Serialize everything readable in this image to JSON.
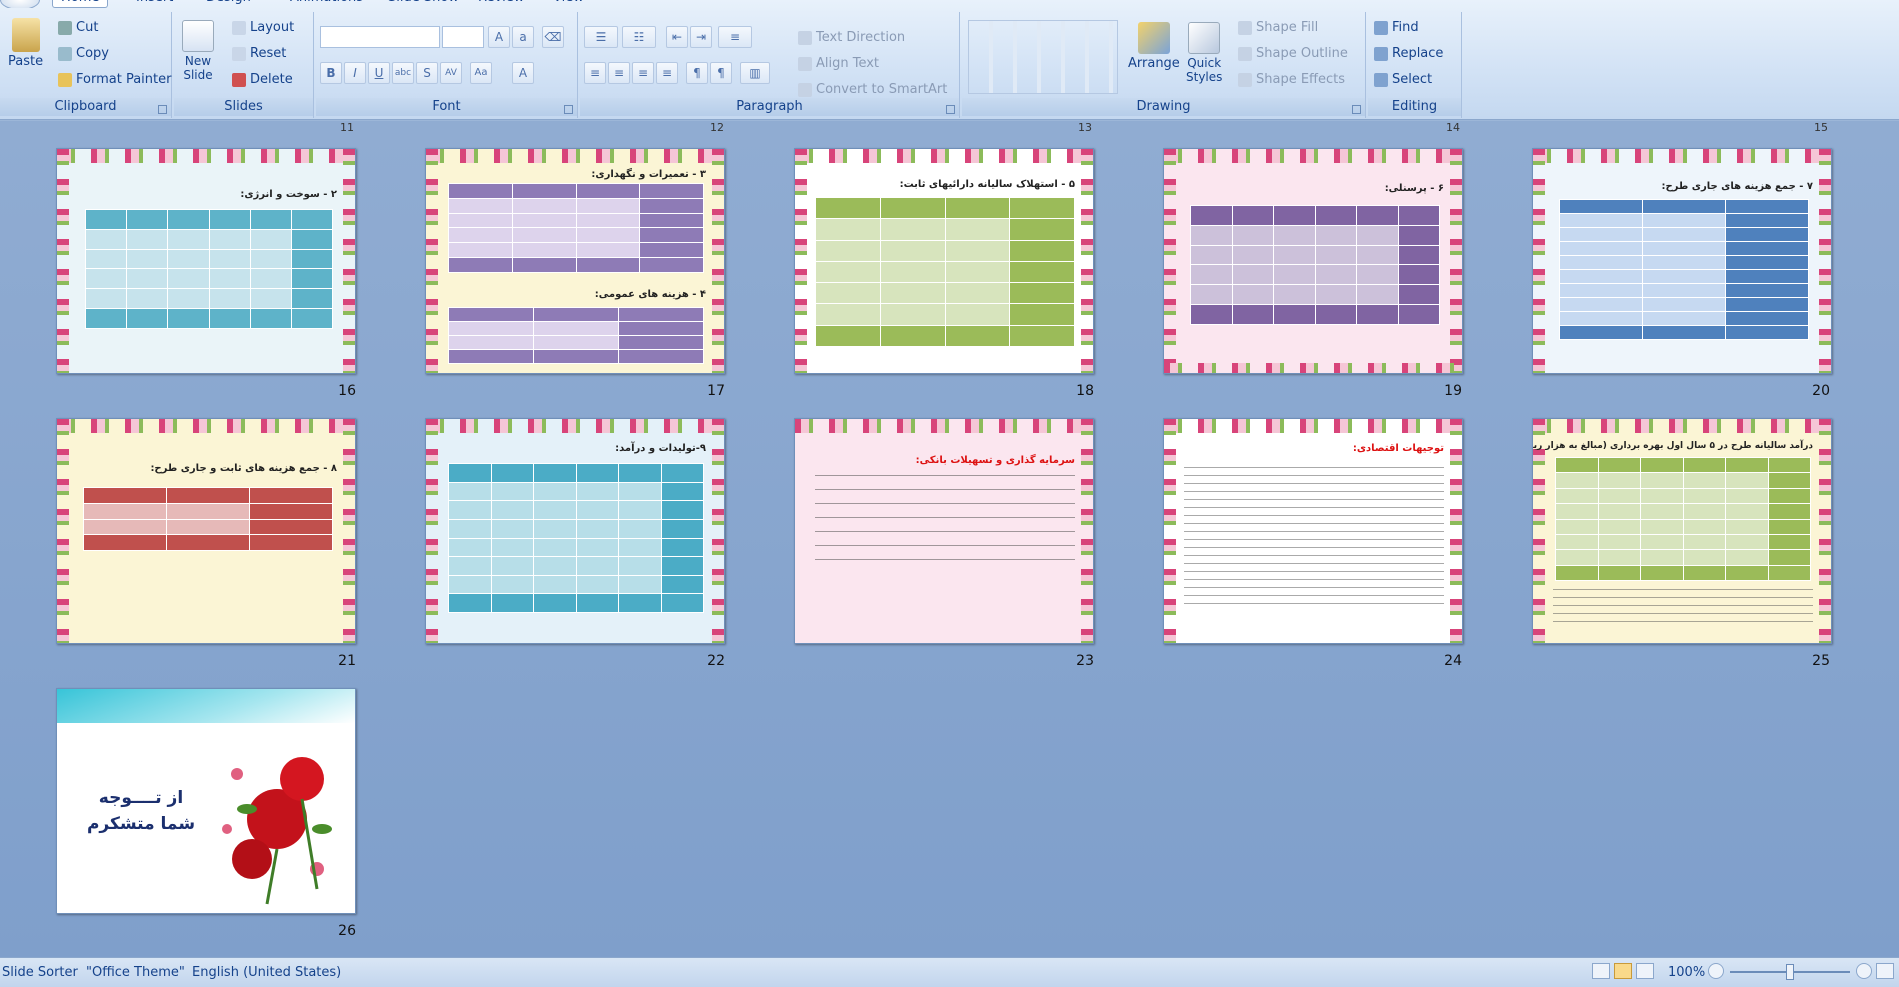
{
  "ribbon": {
    "tabs": [
      "Home",
      "Insert",
      "Design",
      "Animations",
      "Slide Show",
      "Review",
      "View"
    ],
    "groups": {
      "clipboard": "Clipboard",
      "slides": "Slides",
      "font": "Font",
      "paragraph": "Paragraph",
      "drawing": "Drawing",
      "editing": "Editing"
    },
    "clipboard": {
      "paste": "Paste",
      "cut": "Cut",
      "copy": "Copy",
      "format_painter": "Format Painter"
    },
    "slides": {
      "new_slide_1": "New",
      "new_slide_2": "Slide",
      "layout": "Layout",
      "reset": "Reset",
      "delete": "Delete"
    },
    "paragraph": {
      "text_direction": "Text Direction",
      "align_text": "Align Text",
      "smartart": "Convert to SmartArt"
    },
    "drawing": {
      "arrange": "Arrange",
      "quick_styles_1": "Quick",
      "quick_styles_2": "Styles",
      "shape_fill": "Shape Fill",
      "shape_outline": "Shape Outline",
      "shape_effects": "Shape Effects"
    },
    "editing": {
      "find": "Find",
      "replace": "Replace",
      "select": "Select"
    }
  },
  "top_numbers": [
    "11",
    "12",
    "13",
    "14",
    "15"
  ],
  "slides": [
    {
      "num": "16",
      "title": "۲ - سوخت و انرژی:",
      "theme": "#eaf4f8",
      "header": "#5eb3c9",
      "row": "#c6e3ec"
    },
    {
      "num": "17",
      "title": "۳ - تعمیرات و نگهداری:",
      "title2": "۴ - هزینه های عمومی:",
      "theme": "#fbf5d5",
      "header": "#8e7bb6",
      "row": "#ddd3ec"
    },
    {
      "num": "18",
      "title": "۵ - استهلاک سالیانه دارائیهای ثابت:",
      "theme": "#fff",
      "header": "#9bbb59",
      "row": "#d7e4bd"
    },
    {
      "num": "19",
      "title": "۶ - پرسنلی:",
      "theme": "#fbe6ef",
      "header": "#8064a2",
      "row": "#ccc1da"
    },
    {
      "num": "20",
      "title": "۷ - جمع هزینه های جاری طرح:",
      "theme": "#eef5fb",
      "header": "#4f81bd",
      "row": "#c6d9f1"
    },
    {
      "num": "21",
      "title": "۸ - جمع هزینه های ثابت و جاری طرح:",
      "theme": "#fbf5d5",
      "header": "#c0504d",
      "row": "#e6b9b8"
    },
    {
      "num": "22",
      "title": "۹-تولیدات و درآمد:",
      "theme": "#e4f1f9",
      "header": "#4bacc6",
      "row": "#b7dee8"
    },
    {
      "num": "23",
      "title": "سرمایه گذاری و تسهیلات بانکی:",
      "theme": "#fbe6ef"
    },
    {
      "num": "24",
      "title": "توجیهات اقتصادی:",
      "theme": "#fff"
    },
    {
      "num": "25",
      "title": "درآمد سالیانه طرح در ۵ سال اول بهره برداری (مبالغ به هزار ریال)",
      "theme": "#fbf5d5",
      "header": "#9bbb59",
      "row": "#d7e4bd"
    },
    {
      "num": "26",
      "closing_line1": "از تــــوجه",
      "closing_line2": "شما متشکرم"
    }
  ],
  "status": {
    "slide_sorter": "Slide Sorter",
    "theme": "\"Office Theme\"",
    "language": "English (United States)",
    "zoom": "100%"
  }
}
